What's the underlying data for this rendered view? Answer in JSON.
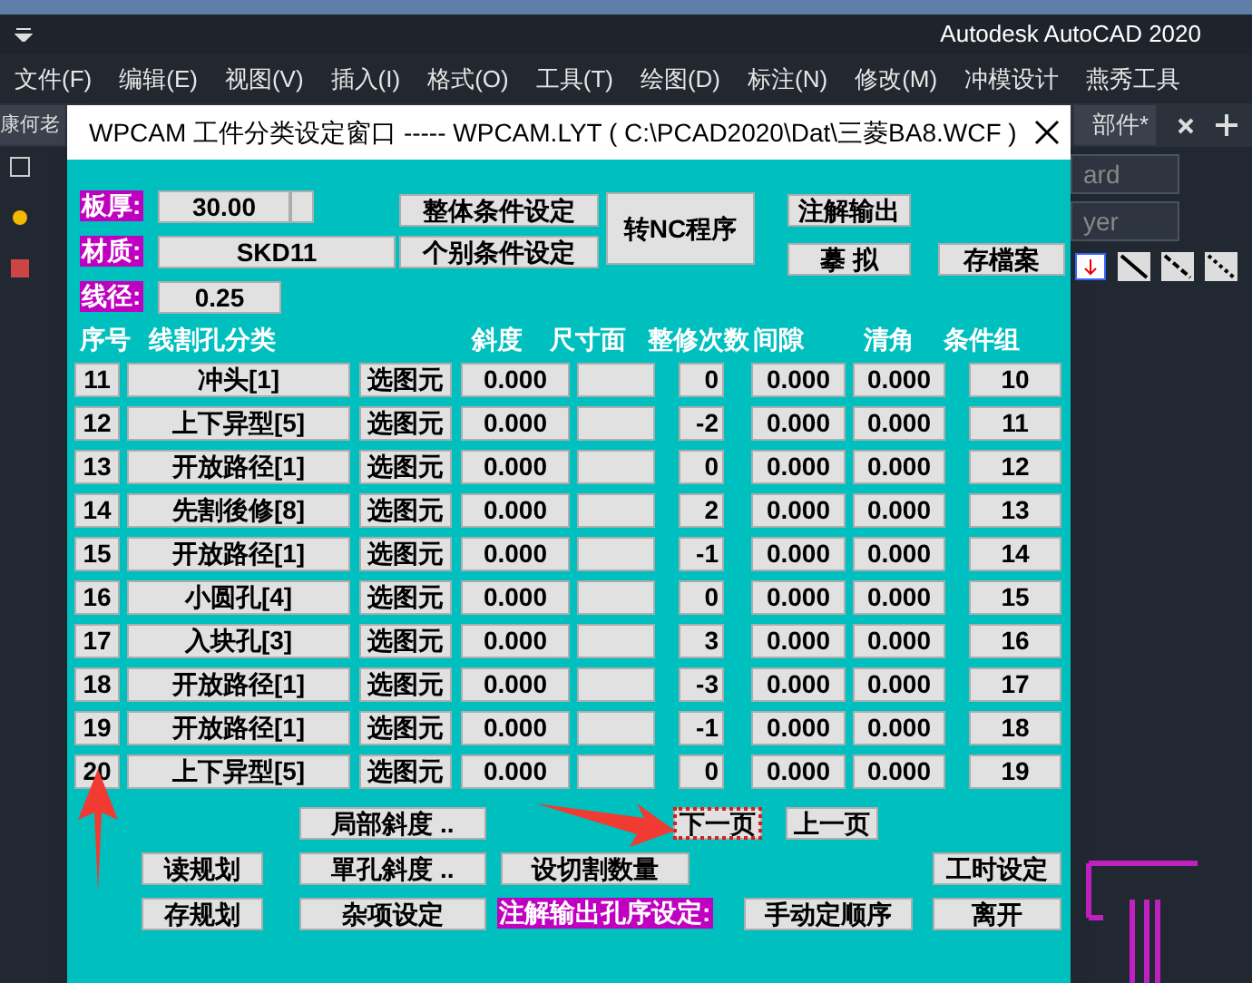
{
  "app": {
    "title": "Autodesk AutoCAD 2020",
    "menu": [
      "文件(F)",
      "编辑(E)",
      "视图(V)",
      "插入(I)",
      "格式(O)",
      "工具(T)",
      "绘图(D)",
      "标注(N)",
      "修改(M)",
      "冲模设计",
      "燕秀工具"
    ],
    "left_tab": "康何老",
    "right_tab": "部件*",
    "dropdowns": [
      "ard",
      "yer"
    ]
  },
  "dialog": {
    "title": "WPCAM 工件分类设定窗口 ----- WPCAM.LYT ( C:\\PCAD2020\\Dat\\三菱BA8.WCF )",
    "fields": [
      {
        "label": "板厚:",
        "value": "30.00"
      },
      {
        "label": "材质:",
        "value": "SKD11"
      },
      {
        "label": "线径:",
        "value": "0.25"
      }
    ],
    "top_buttons": [
      "整体条件设定",
      "个别条件设定",
      "转NC程序",
      "注解输出",
      "摹 拟",
      "存檔案"
    ],
    "columns": [
      "序号",
      "线割孔分类",
      "斜度",
      "尺寸面",
      "整修次数",
      "间隙",
      "清角",
      "条件组"
    ],
    "rows": [
      {
        "no": "11",
        "type": "冲头[1]",
        "pick": "选图元",
        "slope": "0.000",
        "passes": "0",
        "gap": "0.000",
        "corner": "0.000",
        "group": "10"
      },
      {
        "no": "12",
        "type": "上下异型[5]",
        "pick": "选图元",
        "slope": "0.000",
        "passes": "-2",
        "gap": "0.000",
        "corner": "0.000",
        "group": "11"
      },
      {
        "no": "13",
        "type": "开放路径[1]",
        "pick": "选图元",
        "slope": "0.000",
        "passes": "0",
        "gap": "0.000",
        "corner": "0.000",
        "group": "12"
      },
      {
        "no": "14",
        "type": "先割後修[8]",
        "pick": "选图元",
        "slope": "0.000",
        "passes": "2",
        "gap": "0.000",
        "corner": "0.000",
        "group": "13"
      },
      {
        "no": "15",
        "type": "开放路径[1]",
        "pick": "选图元",
        "slope": "0.000",
        "passes": "-1",
        "gap": "0.000",
        "corner": "0.000",
        "group": "14"
      },
      {
        "no": "16",
        "type": "小圆孔[4]",
        "pick": "选图元",
        "slope": "0.000",
        "passes": "0",
        "gap": "0.000",
        "corner": "0.000",
        "group": "15"
      },
      {
        "no": "17",
        "type": "入块孔[3]",
        "pick": "选图元",
        "slope": "0.000",
        "passes": "3",
        "gap": "0.000",
        "corner": "0.000",
        "group": "16"
      },
      {
        "no": "18",
        "type": "开放路径[1]",
        "pick": "选图元",
        "slope": "0.000",
        "passes": "-3",
        "gap": "0.000",
        "corner": "0.000",
        "group": "17"
      },
      {
        "no": "19",
        "type": "开放路径[1]",
        "pick": "选图元",
        "slope": "0.000",
        "passes": "-1",
        "gap": "0.000",
        "corner": "0.000",
        "group": "18"
      },
      {
        "no": "20",
        "type": "上下异型[5]",
        "pick": "选图元",
        "slope": "0.000",
        "passes": "0",
        "gap": "0.000",
        "corner": "0.000",
        "group": "19"
      }
    ],
    "bottom_buttons": [
      {
        "label": "局部斜度 ..",
        "focused": false
      },
      {
        "label": "下一页",
        "focused": true
      },
      {
        "label": "上一页",
        "focused": false
      },
      {
        "label": "读规划",
        "focused": false
      },
      {
        "label": "單孔斜度 ..",
        "focused": false
      },
      {
        "label": "设切割数量",
        "focused": false
      },
      {
        "label": "工时设定",
        "focused": false
      },
      {
        "label": "存规划",
        "focused": false
      },
      {
        "label": "杂项设定",
        "focused": false
      },
      {
        "label": "手动定顺序",
        "focused": false
      },
      {
        "label": "离开",
        "focused": false
      }
    ],
    "order_label": "注解输出孔序设定:"
  }
}
